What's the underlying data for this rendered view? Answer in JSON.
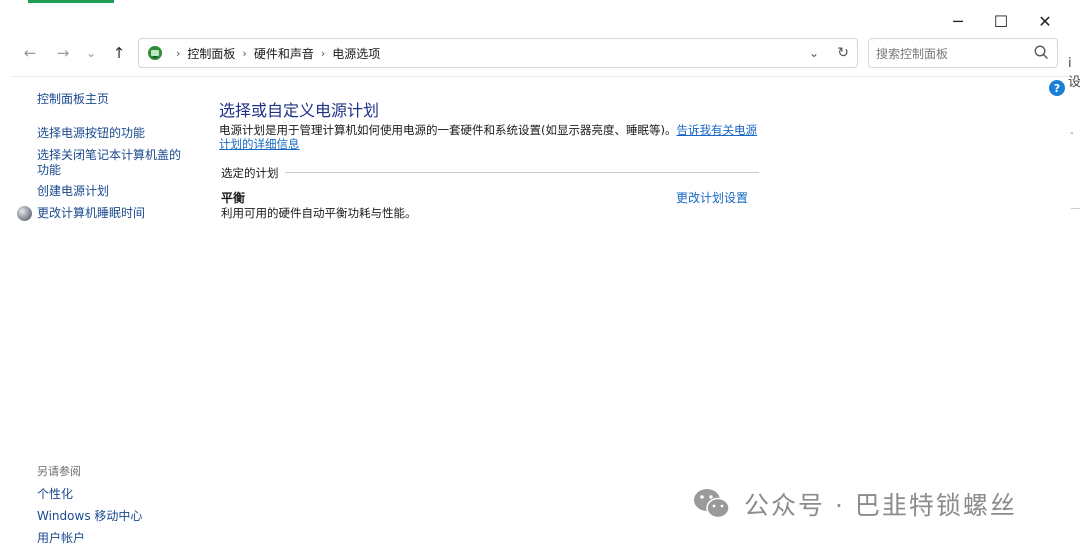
{
  "window": {
    "controls": {
      "minimize": "─",
      "maximize": "☐",
      "close": "✕"
    }
  },
  "nav": {
    "back": "←",
    "forward": "→",
    "recent": "⌄",
    "up": "↑",
    "breadcrumb_sep": "›",
    "breadcrumbs": [
      "控制面板",
      "硬件和声音",
      "电源选项"
    ],
    "dropdown": "⌄",
    "refresh": "↻"
  },
  "search": {
    "placeholder": "搜索控制面板"
  },
  "help": {
    "label": "?"
  },
  "edge": {
    "text": "i设",
    "dash": "-"
  },
  "sidebar": {
    "home": "控制面板主页",
    "links": [
      "选择电源按钮的功能",
      "选择关闭笔记本计算机盖的功能",
      "创建电源计划",
      "更改计算机睡眠时间"
    ]
  },
  "see_also": {
    "title": "另请参阅",
    "links": [
      "个性化",
      "Windows 移动中心",
      "用户帐户"
    ]
  },
  "main": {
    "title": "选择或自定义电源计划",
    "description": "电源计划是用于管理计算机如何使用电源的一套硬件和系统设置(如显示器亮度、睡眠等)。",
    "learn_more": "告诉我有关电源计划的详细信息",
    "group_label": "选定的计划",
    "plan": {
      "name": "平衡",
      "description": "利用可用的硬件自动平衡功耗与性能。",
      "change_link": "更改计划设置"
    }
  },
  "watermark": {
    "text": "公众号 · 巴韭特锁螺丝"
  },
  "colors": {
    "link": "#1668c4",
    "title": "#1e3287",
    "sidebar_link": "#1a4a8f",
    "accent": "#1f9d55",
    "help": "#1c7fd6"
  },
  "icons": [
    "control-panel-icon",
    "search-icon",
    "help-icon",
    "moon-icon",
    "wechat-icon"
  ]
}
